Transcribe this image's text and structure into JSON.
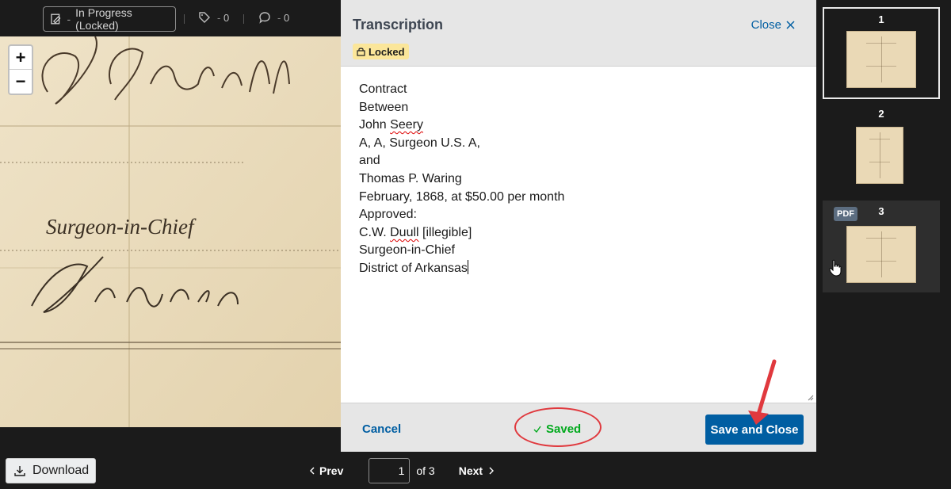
{
  "toolbar": {
    "status_label": "In Progress (Locked)",
    "tag_count": "0",
    "comment_count": "0"
  },
  "viewer": {
    "zoom_in": "+",
    "zoom_out": "−",
    "image_text": "Surgeon-in-Chief"
  },
  "panel": {
    "title": "Transcription",
    "close_label": "Close",
    "locked_label": "Locked",
    "cancel_label": "Cancel",
    "saved_label": "Saved",
    "save_close_label": "Save and Close",
    "transcription_lines": [
      "Contract",
      "Between",
      "John Seery",
      "A, A, Surgeon U.S. A,",
      "and",
      "Thomas P. Waring",
      "February, 1868, at $50.00 per month",
      "Approved:",
      "C.W. Duull [illegible]",
      "Surgeon-in-Chief",
      "District of Arkansas"
    ]
  },
  "bottom": {
    "download_label": "Download",
    "prev_label": "Prev",
    "page_value": "1",
    "of_label": "of 3",
    "next_label": "Next"
  },
  "thumbnails": [
    {
      "number": "1",
      "active": true
    },
    {
      "number": "2",
      "active": false
    },
    {
      "number": "3",
      "active": false,
      "tag": "PDF"
    }
  ],
  "colors": {
    "link_blue": "#005ea2",
    "saved_green": "#00a91c",
    "annotation_red": "#e0393e",
    "locked_yellow": "#fbe69a"
  }
}
